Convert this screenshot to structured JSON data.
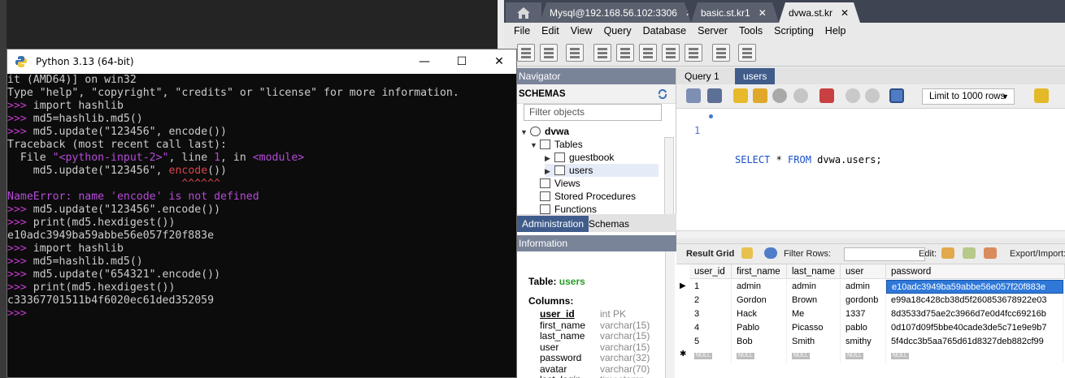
{
  "python": {
    "title": "Python 3.13 (64-bit)",
    "controls": {
      "minimize": "—",
      "maximize": "☐",
      "close": "✕"
    },
    "lines": [
      {
        "segments": [
          {
            "t": "it (AMD64)] on win32",
            "c": ""
          }
        ]
      },
      {
        "segments": [
          {
            "t": "Type \"help\", \"copyright\", \"credits\" or \"license\" for more information.",
            "c": ""
          }
        ]
      },
      {
        "segments": [
          {
            "t": ">>> ",
            "c": "prompt"
          },
          {
            "t": "import hashlib",
            "c": ""
          }
        ]
      },
      {
        "segments": [
          {
            "t": ">>> ",
            "c": "prompt"
          },
          {
            "t": "md5=hashlib.md5()",
            "c": ""
          }
        ]
      },
      {
        "segments": [
          {
            "t": ">>> ",
            "c": "prompt"
          },
          {
            "t": "md5.update(\"123456\", encode())",
            "c": ""
          }
        ]
      },
      {
        "segments": [
          {
            "t": "Traceback (most recent call last):",
            "c": ""
          }
        ]
      },
      {
        "segments": [
          {
            "t": "  File ",
            "c": ""
          },
          {
            "t": "\"<python-input-2>\"",
            "c": "purple"
          },
          {
            "t": ", line ",
            "c": ""
          },
          {
            "t": "1",
            "c": "purple"
          },
          {
            "t": ", in ",
            "c": ""
          },
          {
            "t": "<module>",
            "c": "purple"
          }
        ]
      },
      {
        "segments": [
          {
            "t": "    md5.update(\"123456\", ",
            "c": ""
          },
          {
            "t": "encode",
            "c": "red"
          },
          {
            "t": "())",
            "c": ""
          }
        ]
      },
      {
        "segments": [
          {
            "t": "                           ^^^^^^",
            "c": "red"
          }
        ]
      },
      {
        "segments": [
          {
            "t": "NameError",
            "c": "purple"
          },
          {
            "t": ": name 'encode' is not defined",
            "c": "purple"
          }
        ]
      },
      {
        "segments": [
          {
            "t": ">>> ",
            "c": "prompt"
          },
          {
            "t": "md5.update(\"123456\".encode())",
            "c": ""
          }
        ]
      },
      {
        "segments": [
          {
            "t": ">>> ",
            "c": "prompt"
          },
          {
            "t": "print(md5.hexdigest())",
            "c": ""
          }
        ]
      },
      {
        "segments": [
          {
            "t": "e10adc3949ba59abbe56e057f20f883e",
            "c": ""
          }
        ]
      },
      {
        "segments": [
          {
            "t": ">>> ",
            "c": "prompt"
          },
          {
            "t": "import hashlib",
            "c": ""
          }
        ]
      },
      {
        "segments": [
          {
            "t": ">>> ",
            "c": "prompt"
          },
          {
            "t": "md5=hashlib.md5()",
            "c": ""
          }
        ]
      },
      {
        "segments": [
          {
            "t": ">>> ",
            "c": "prompt"
          },
          {
            "t": "md5.update(\"654321\".encode())",
            "c": ""
          }
        ]
      },
      {
        "segments": [
          {
            "t": ">>> ",
            "c": "prompt"
          },
          {
            "t": "print(md5.hexdigest())",
            "c": ""
          }
        ]
      },
      {
        "segments": [
          {
            "t": "c33367701511b4f6020ec61ded352059",
            "c": ""
          }
        ]
      },
      {
        "segments": [
          {
            "t": ">>>",
            "c": "prompt"
          }
        ]
      }
    ]
  },
  "workbench": {
    "tabs": [
      {
        "label": "Mysql@192.168.56.102:3306",
        "active": false
      },
      {
        "label": "basic.st.kr1",
        "active": false
      },
      {
        "label": "dvwa.st.kr",
        "active": true
      }
    ],
    "tab_close": "✕",
    "menu": [
      "File",
      "Edit",
      "View",
      "Query",
      "Database",
      "Server",
      "Tools",
      "Scripting",
      "Help"
    ],
    "navigator": {
      "header": "Navigator",
      "schemas_label": "SCHEMAS",
      "filter_placeholder": "Filter objects",
      "tree": {
        "schema": "dvwa",
        "tables": "Tables",
        "table_items": [
          "guestbook",
          "users"
        ],
        "views": "Views",
        "procedures": "Stored Procedures",
        "functions": "Functions"
      },
      "tabs": [
        "Administration",
        "Schemas"
      ]
    },
    "information": {
      "header": "Information",
      "table_label": "Table:",
      "table_name": "users",
      "columns_label": "Columns:",
      "columns": [
        {
          "name": "user_id",
          "type": "int PK"
        },
        {
          "name": "first_name",
          "type": "varchar(15)"
        },
        {
          "name": "last_name",
          "type": "varchar(15)"
        },
        {
          "name": "user",
          "type": "varchar(15)"
        },
        {
          "name": "password",
          "type": "varchar(32)"
        },
        {
          "name": "avatar",
          "type": "varchar(70)"
        },
        {
          "name": "last_login",
          "type": "timestamp"
        }
      ]
    },
    "editor": {
      "tabs": [
        "Query 1",
        "users"
      ],
      "limit": "Limit to 1000 rows",
      "line_number": "1",
      "sql_keyword1": "SELECT",
      "sql_star": " * ",
      "sql_keyword2": "FROM",
      "sql_rest": " dvwa.users;"
    },
    "result": {
      "result_grid": "Result Grid",
      "filter_rows": "Filter Rows:",
      "edit": "Edit:",
      "export": "Export/Import:",
      "columns": [
        "user_id",
        "first_name",
        "last_name",
        "user",
        "password"
      ],
      "rows": [
        [
          "1",
          "admin",
          "admin",
          "admin",
          "e10adc3949ba59abbe56e057f20f883e"
        ],
        [
          "2",
          "Gordon",
          "Brown",
          "gordonb",
          "e99a18c428cb38d5f260853678922e03"
        ],
        [
          "3",
          "Hack",
          "Me",
          "1337",
          "8d3533d75ae2c3966d7e0d4fcc69216b"
        ],
        [
          "4",
          "Pablo",
          "Picasso",
          "pablo",
          "0d107d09f5bbe40cade3de5c71e9e9b7"
        ],
        [
          "5",
          "Bob",
          "Smith",
          "smithy",
          "5f4dcc3b5aa765d61d8327deb882cf99"
        ]
      ],
      "null_label": "NULL",
      "current_row_marker": "▶",
      "new_row_marker": "✱"
    }
  }
}
